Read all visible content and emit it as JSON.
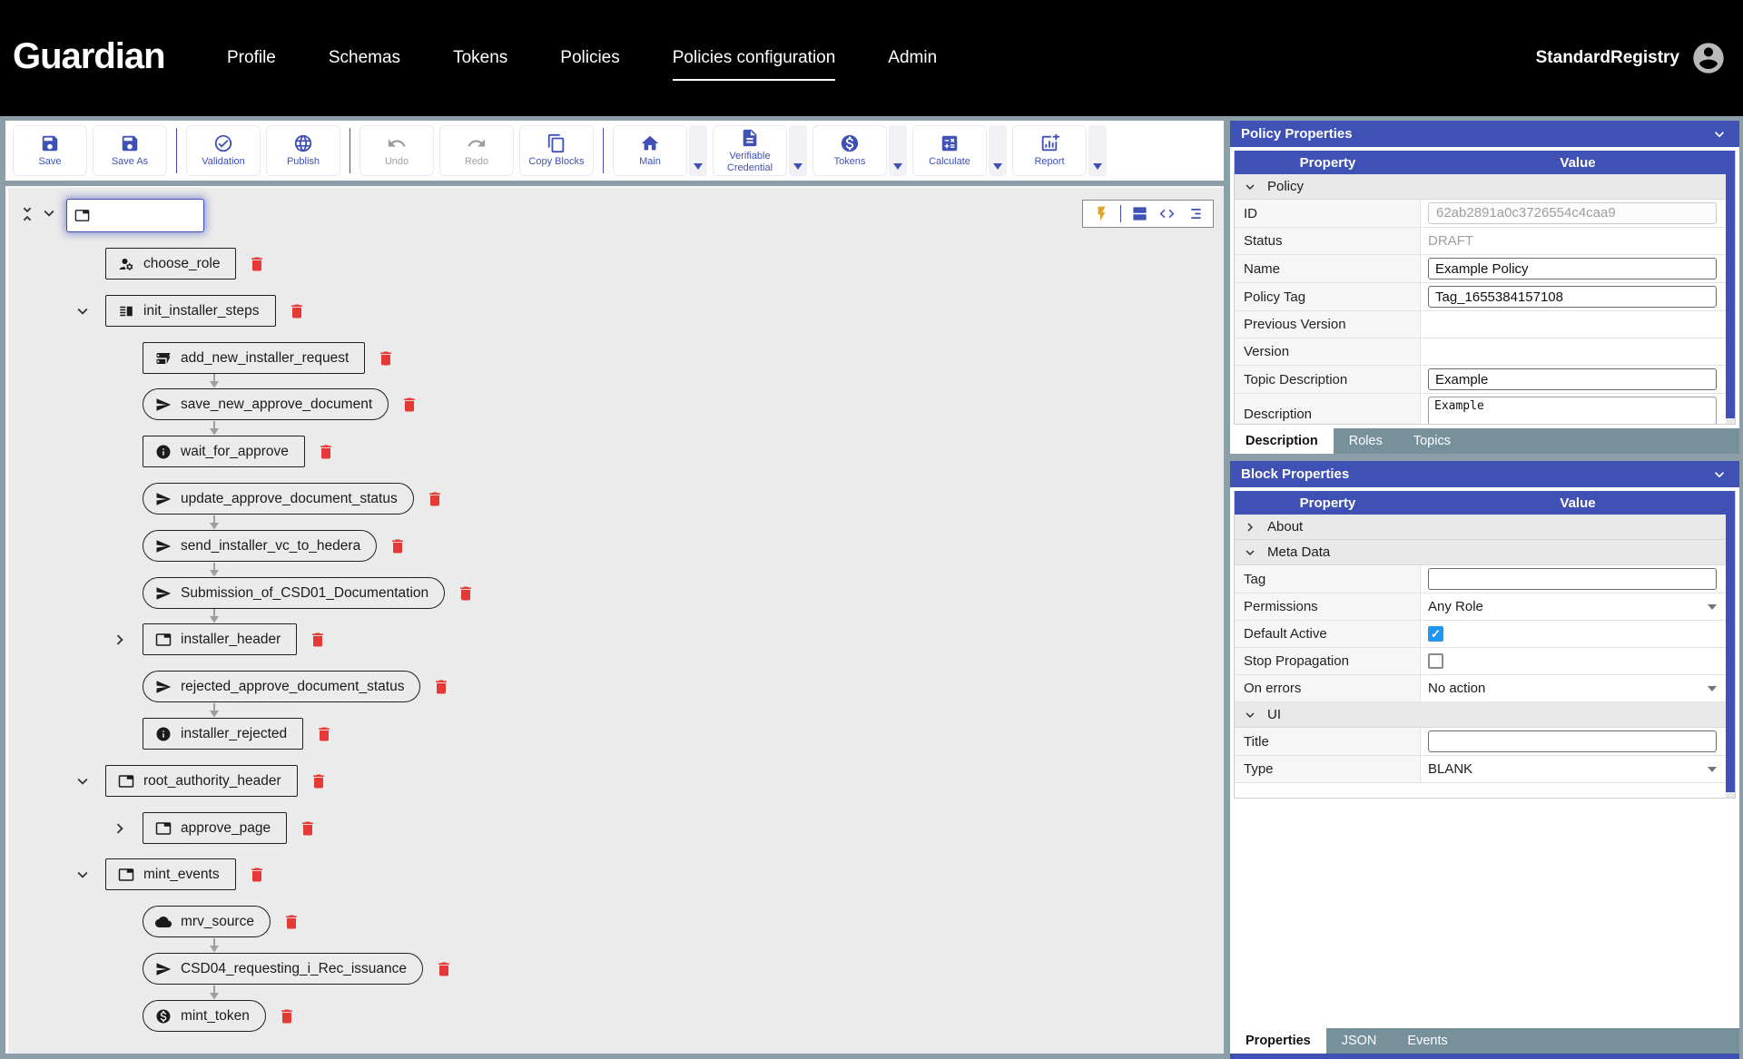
{
  "nav": {
    "brand": "Guardian",
    "items": [
      {
        "label": "Profile",
        "active": false
      },
      {
        "label": "Schemas",
        "active": false
      },
      {
        "label": "Tokens",
        "active": false
      },
      {
        "label": "Policies",
        "active": false
      },
      {
        "label": "Policies configuration",
        "active": true
      },
      {
        "label": "Admin",
        "active": false
      }
    ],
    "user": "StandardRegistry"
  },
  "toolbar": {
    "groups": [
      [
        {
          "label": "Save",
          "icon": "save",
          "disabled": false,
          "dropdown": false
        },
        {
          "label": "Save As",
          "icon": "save",
          "disabled": false,
          "dropdown": false
        }
      ],
      [
        {
          "label": "Validation",
          "icon": "check-circle",
          "disabled": false,
          "dropdown": false
        },
        {
          "label": "Publish",
          "icon": "globe",
          "disabled": false,
          "dropdown": false
        }
      ],
      [
        {
          "label": "Undo",
          "icon": "undo",
          "disabled": true,
          "dropdown": false
        },
        {
          "label": "Redo",
          "icon": "redo",
          "disabled": true,
          "dropdown": false
        },
        {
          "label": "Copy Blocks",
          "icon": "copy",
          "disabled": false,
          "dropdown": false
        }
      ],
      [
        {
          "label": "Main",
          "icon": "home",
          "disabled": false,
          "dropdown": true
        },
        {
          "label": "Verifiable Credential",
          "icon": "document",
          "disabled": false,
          "dropdown": true
        },
        {
          "label": "Tokens",
          "icon": "token",
          "disabled": false,
          "dropdown": true
        },
        {
          "label": "Calculate",
          "icon": "calculate",
          "disabled": false,
          "dropdown": true
        },
        {
          "label": "Report",
          "icon": "report",
          "disabled": false,
          "dropdown": true
        }
      ]
    ]
  },
  "canvas": {
    "search_value": "",
    "nodes": [
      {
        "tag": "choose_role",
        "icon": "role",
        "shape": "rect",
        "indent": 0,
        "chevron": null,
        "arrow_before": false
      },
      {
        "tag": "init_installer_steps",
        "icon": "steps",
        "shape": "rect",
        "indent": 0,
        "chevron": "down",
        "arrow_before": false
      },
      {
        "tag": "add_new_installer_request",
        "icon": "form",
        "shape": "rect",
        "indent": 1,
        "chevron": null,
        "arrow_before": false
      },
      {
        "tag": "save_new_approve_document",
        "icon": "send",
        "shape": "pill",
        "indent": 1,
        "chevron": null,
        "arrow_before": true
      },
      {
        "tag": "wait_for_approve",
        "icon": "info",
        "shape": "rect",
        "indent": 1,
        "chevron": null,
        "arrow_before": true
      },
      {
        "tag": "update_approve_document_status",
        "icon": "send",
        "shape": "pill",
        "indent": 1,
        "chevron": null,
        "arrow_before": false
      },
      {
        "tag": "send_installer_vc_to_hedera",
        "icon": "send",
        "shape": "pill",
        "indent": 1,
        "chevron": null,
        "arrow_before": true
      },
      {
        "tag": "Submission_of_CSD01_Documentation",
        "icon": "send",
        "shape": "pill",
        "indent": 1,
        "chevron": null,
        "arrow_before": true
      },
      {
        "tag": "installer_header",
        "icon": "container",
        "shape": "rect",
        "indent": 1,
        "chevron": "right",
        "arrow_before": true
      },
      {
        "tag": "rejected_approve_document_status",
        "icon": "send",
        "shape": "pill",
        "indent": 1,
        "chevron": null,
        "arrow_before": false
      },
      {
        "tag": "installer_rejected",
        "icon": "info",
        "shape": "rect",
        "indent": 1,
        "chevron": null,
        "arrow_before": true
      },
      {
        "tag": "root_authority_header",
        "icon": "container",
        "shape": "rect",
        "indent": 0,
        "chevron": "down",
        "arrow_before": false
      },
      {
        "tag": "approve_page",
        "icon": "container",
        "shape": "rect",
        "indent": 1,
        "chevron": "right",
        "arrow_before": false
      },
      {
        "tag": "mint_events",
        "icon": "container",
        "shape": "rect",
        "indent": 0,
        "chevron": "down",
        "arrow_before": false
      },
      {
        "tag": "mrv_source",
        "icon": "cloud",
        "shape": "pill",
        "indent": 1,
        "chevron": null,
        "arrow_before": false
      },
      {
        "tag": "CSD04_requesting_i_Rec_issuance",
        "icon": "send",
        "shape": "pill",
        "indent": 1,
        "chevron": null,
        "arrow_before": true
      },
      {
        "tag": "mint_token",
        "icon": "token",
        "shape": "pill",
        "indent": 1,
        "chevron": null,
        "arrow_before": true
      }
    ]
  },
  "policy_properties": {
    "title": "Policy Properties",
    "columns": [
      "Property",
      "Value"
    ],
    "rows": [
      {
        "label": "Policy",
        "type": "group",
        "expanded": true
      },
      {
        "label": "ID",
        "type": "readonly_box",
        "value": "62ab2891a0c3726554c4caa9"
      },
      {
        "label": "Status",
        "type": "readonly_text",
        "value": "DRAFT"
      },
      {
        "label": "Name",
        "type": "input",
        "value": "Example Policy"
      },
      {
        "label": "Policy Tag",
        "type": "input",
        "value": "Tag_1655384157108"
      },
      {
        "label": "Previous Version",
        "type": "empty",
        "value": ""
      },
      {
        "label": "Version",
        "type": "empty",
        "value": ""
      },
      {
        "label": "Topic Description",
        "type": "input",
        "value": "Example"
      },
      {
        "label": "Description",
        "type": "textarea",
        "value": "Example"
      }
    ],
    "tabs": {
      "items": [
        "Description",
        "Roles",
        "Topics"
      ],
      "active": "Description"
    }
  },
  "block_properties": {
    "title": "Block Properties",
    "columns": [
      "Property",
      "Value"
    ],
    "rows": [
      {
        "label": "About",
        "type": "group",
        "expanded": false
      },
      {
        "label": "Meta Data",
        "type": "group",
        "expanded": true
      },
      {
        "label": "Tag",
        "type": "input",
        "value": ""
      },
      {
        "label": "Permissions",
        "type": "select",
        "value": "Any Role"
      },
      {
        "label": "Default Active",
        "type": "checkbox",
        "checked": true
      },
      {
        "label": "Stop Propagation",
        "type": "checkbox",
        "checked": false
      },
      {
        "label": "On errors",
        "type": "select",
        "value": "No action"
      },
      {
        "label": "UI",
        "type": "group",
        "expanded": true
      },
      {
        "label": "Title",
        "type": "input",
        "value": ""
      },
      {
        "label": "Type",
        "type": "select",
        "value": "BLANK"
      }
    ],
    "tabs": {
      "items": [
        "Properties",
        "JSON",
        "Events"
      ],
      "active": "Properties"
    }
  },
  "colors": {
    "accent": "#3f51b5",
    "danger": "#e53935",
    "checkbox_on": "#2196f3",
    "flash": "#dfa32b",
    "canvas_bg": "#ebebeb",
    "body_slate": "#8c9fa9"
  }
}
